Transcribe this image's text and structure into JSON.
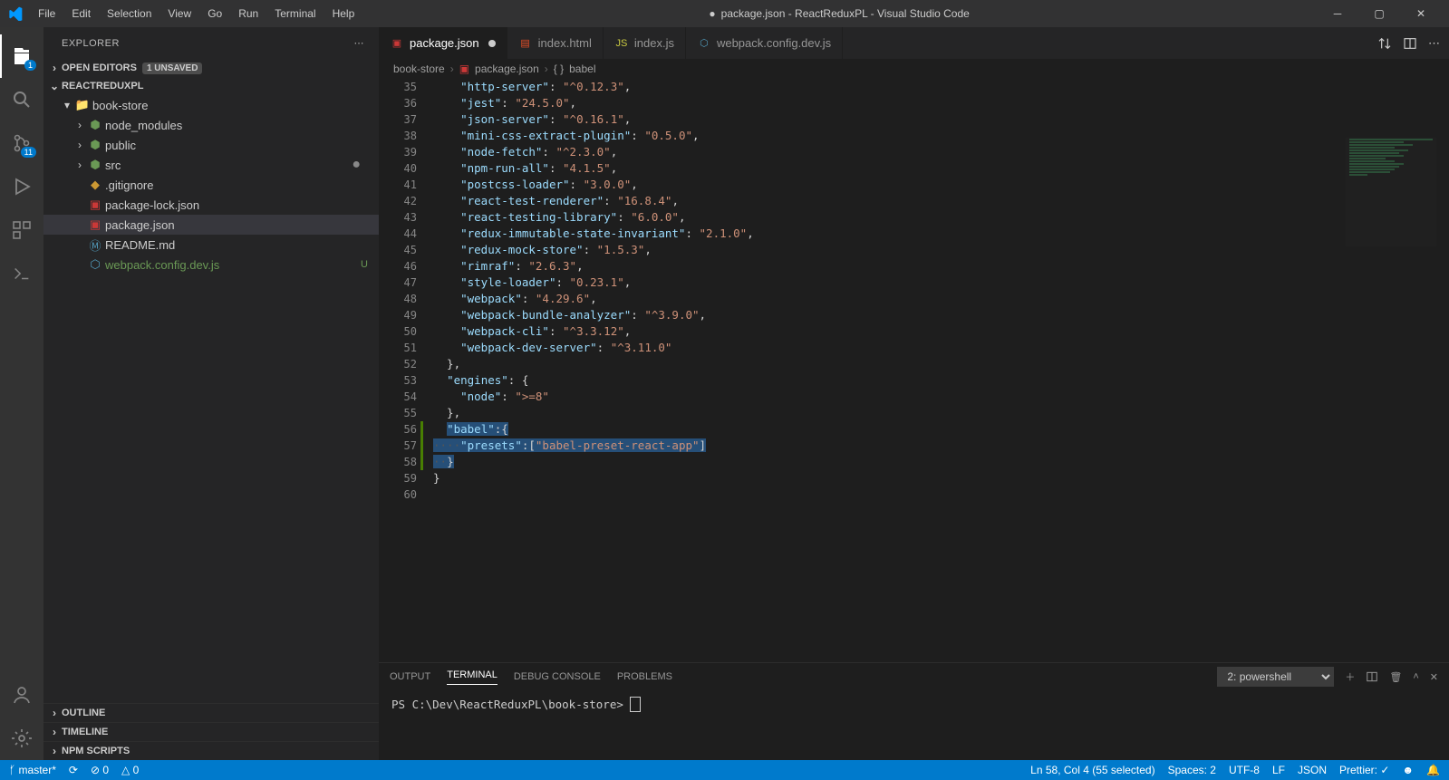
{
  "titlebar": {
    "menus": [
      "File",
      "Edit",
      "Selection",
      "View",
      "Go",
      "Run",
      "Terminal",
      "Help"
    ],
    "title": "package.json - ReactReduxPL - Visual Studio Code",
    "modified_indicator": "●"
  },
  "activitybar": {
    "explorer_badge": "1",
    "scm_badge": "11"
  },
  "sidebar": {
    "header": "EXPLORER",
    "open_editors": {
      "label": "OPEN EDITORS",
      "badge": "1 UNSAVED"
    },
    "project": "REACTREDUXPL",
    "tree": [
      {
        "type": "folder",
        "open": true,
        "depth": 0,
        "name": "book-store",
        "chev": "▾",
        "iconColor": "col-icon",
        "icon": "📁"
      },
      {
        "type": "folder",
        "open": false,
        "depth": 1,
        "name": "node_modules",
        "chev": "›",
        "iconColor": "green-icon",
        "icon": "⬢"
      },
      {
        "type": "folder",
        "open": false,
        "depth": 1,
        "name": "public",
        "chev": "›",
        "iconColor": "green-icon",
        "icon": "⬢"
      },
      {
        "type": "folder",
        "open": false,
        "depth": 1,
        "name": "src",
        "chev": "›",
        "iconColor": "green-icon",
        "icon": "⬢",
        "dot": true
      },
      {
        "type": "file",
        "depth": 1,
        "name": ".gitignore",
        "iconColor": "col-icon",
        "icon": "◆"
      },
      {
        "type": "file",
        "depth": 1,
        "name": "package-lock.json",
        "iconColor": "npm-icon",
        "icon": "▣"
      },
      {
        "type": "file",
        "depth": 1,
        "name": "package.json",
        "iconColor": "npm-icon",
        "icon": "▣",
        "active": true
      },
      {
        "type": "file",
        "depth": 1,
        "name": "README.md",
        "iconColor": "md-icon",
        "icon": "Ⓜ"
      },
      {
        "type": "file",
        "depth": 1,
        "name": "webpack.config.dev.js",
        "iconColor": "blue-icon",
        "icon": "⬡",
        "u": "U",
        "nameColor": "#6a9955"
      }
    ],
    "outline": "OUTLINE",
    "timeline": "TIMELINE",
    "npm_scripts": "NPM SCRIPTS"
  },
  "tabs": [
    {
      "label": "package.json",
      "iconColor": "npm-icon",
      "icon": "▣",
      "active": true,
      "modified": true
    },
    {
      "label": "index.html",
      "iconColor": "html-icon",
      "icon": "▤"
    },
    {
      "label": "index.js",
      "iconColor": "js-icon",
      "icon": "JS"
    },
    {
      "label": "webpack.config.dev.js",
      "iconColor": "blue-icon",
      "icon": "⬡"
    }
  ],
  "breadcrumb": {
    "a": "book-store",
    "b": "package.json",
    "c": "babel",
    "icon1": "▣",
    "icon2": "{ }"
  },
  "code": {
    "start": 35,
    "lines": [
      [
        [
          "k",
          "\"http-server\""
        ],
        [
          "p",
          ": "
        ],
        [
          "s",
          "\"^0.12.3\""
        ],
        [
          "p",
          ","
        ]
      ],
      [
        [
          "k",
          "\"jest\""
        ],
        [
          "p",
          ": "
        ],
        [
          "s",
          "\"24.5.0\""
        ],
        [
          "p",
          ","
        ]
      ],
      [
        [
          "k",
          "\"json-server\""
        ],
        [
          "p",
          ": "
        ],
        [
          "s",
          "\"^0.16.1\""
        ],
        [
          "p",
          ","
        ]
      ],
      [
        [
          "k",
          "\"mini-css-extract-plugin\""
        ],
        [
          "p",
          ": "
        ],
        [
          "s",
          "\"0.5.0\""
        ],
        [
          "p",
          ","
        ]
      ],
      [
        [
          "k",
          "\"node-fetch\""
        ],
        [
          "p",
          ": "
        ],
        [
          "s",
          "\"^2.3.0\""
        ],
        [
          "p",
          ","
        ]
      ],
      [
        [
          "k",
          "\"npm-run-all\""
        ],
        [
          "p",
          ": "
        ],
        [
          "s",
          "\"4.1.5\""
        ],
        [
          "p",
          ","
        ]
      ],
      [
        [
          "k",
          "\"postcss-loader\""
        ],
        [
          "p",
          ": "
        ],
        [
          "s",
          "\"3.0.0\""
        ],
        [
          "p",
          ","
        ]
      ],
      [
        [
          "k",
          "\"react-test-renderer\""
        ],
        [
          "p",
          ": "
        ],
        [
          "s",
          "\"16.8.4\""
        ],
        [
          "p",
          ","
        ]
      ],
      [
        [
          "k",
          "\"react-testing-library\""
        ],
        [
          "p",
          ": "
        ],
        [
          "s",
          "\"6.0.0\""
        ],
        [
          "p",
          ","
        ]
      ],
      [
        [
          "k",
          "\"redux-immutable-state-invariant\""
        ],
        [
          "p",
          ": "
        ],
        [
          "s",
          "\"2.1.0\""
        ],
        [
          "p",
          ","
        ]
      ],
      [
        [
          "k",
          "\"redux-mock-store\""
        ],
        [
          "p",
          ": "
        ],
        [
          "s",
          "\"1.5.3\""
        ],
        [
          "p",
          ","
        ]
      ],
      [
        [
          "k",
          "\"rimraf\""
        ],
        [
          "p",
          ": "
        ],
        [
          "s",
          "\"2.6.3\""
        ],
        [
          "p",
          ","
        ]
      ],
      [
        [
          "k",
          "\"style-loader\""
        ],
        [
          "p",
          ": "
        ],
        [
          "s",
          "\"0.23.1\""
        ],
        [
          "p",
          ","
        ]
      ],
      [
        [
          "k",
          "\"webpack\""
        ],
        [
          "p",
          ": "
        ],
        [
          "s",
          "\"4.29.6\""
        ],
        [
          "p",
          ","
        ]
      ],
      [
        [
          "k",
          "\"webpack-bundle-analyzer\""
        ],
        [
          "p",
          ": "
        ],
        [
          "s",
          "\"^3.9.0\""
        ],
        [
          "p",
          ","
        ]
      ],
      [
        [
          "k",
          "\"webpack-cli\""
        ],
        [
          "p",
          ": "
        ],
        [
          "s",
          "\"^3.3.12\""
        ],
        [
          "p",
          ","
        ]
      ],
      [
        [
          "k",
          "\"webpack-dev-server\""
        ],
        [
          "p",
          ": "
        ],
        [
          "s",
          "\"^3.11.0\""
        ]
      ]
    ],
    "tail": {
      "l52": "  },",
      "l53_a": "\"engines\"",
      "l53_b": ": {",
      "l54_a": "\"node\"",
      "l54_b": ": ",
      "l54_c": "\">=8\"",
      "l55": "  },",
      "l56_a": "\"babel\"",
      "l56_b": ":{",
      "l57_a": "\"presets\"",
      "l57_b": ":[",
      "l57_c": "\"babel-preset-react-app\"",
      "l57_d": "]",
      "l58": "  }",
      "l59": "}",
      "l60": ""
    }
  },
  "panel": {
    "tabs": [
      "OUTPUT",
      "TERMINAL",
      "DEBUG CONSOLE",
      "PROBLEMS"
    ],
    "dropdown": "2: powershell",
    "prompt": "PS C:\\Dev\\ReactReduxPL\\book-store> "
  },
  "status": {
    "branch": "master*",
    "sync": "⟳",
    "errors": "⊘ 0",
    "warnings": "△ 0",
    "ln": "Ln 58, Col 4 (55 selected)",
    "spaces": "Spaces: 2",
    "enc": "UTF-8",
    "eol": "LF",
    "lang": "JSON",
    "prettier": "Prettier: ✓",
    "bell": "🔔"
  }
}
